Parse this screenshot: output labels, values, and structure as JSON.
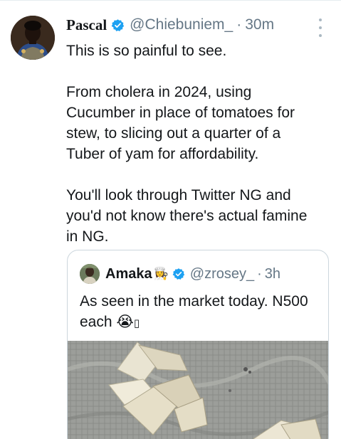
{
  "tweet": {
    "author_name": "Pascal",
    "author_handle": "@Chiebuniem_",
    "separator": "·",
    "time": "30m",
    "verified_icon": "verified-badge-icon",
    "more_icon": "more-vertical-icon",
    "body": [
      "This is so painful to see.",
      "",
      "From cholera in 2024, using",
      "Cucumber in place of tomatoes for",
      "stew, to slicing out a quarter of a",
      "Tuber of yam for affordability.",
      "",
      "You'll look through Twitter NG and",
      "you'd not know there's actual famine",
      "in NG."
    ]
  },
  "quoted_tweet": {
    "author_name": "Amaka",
    "author_emoji": "👩‍🍳",
    "author_handle": "@zrosey_",
    "separator": "·",
    "time": "3h",
    "text_line1": "As seen in the market today. N500",
    "text_line2": "each 😭",
    "text_line2_trailing": "▯",
    "image_alt": "yam-slices-photo"
  },
  "colors": {
    "text_primary": "#14171a",
    "text_secondary": "#657786",
    "verified_blue": "#1da1f2",
    "border": "#ccd6dd"
  }
}
